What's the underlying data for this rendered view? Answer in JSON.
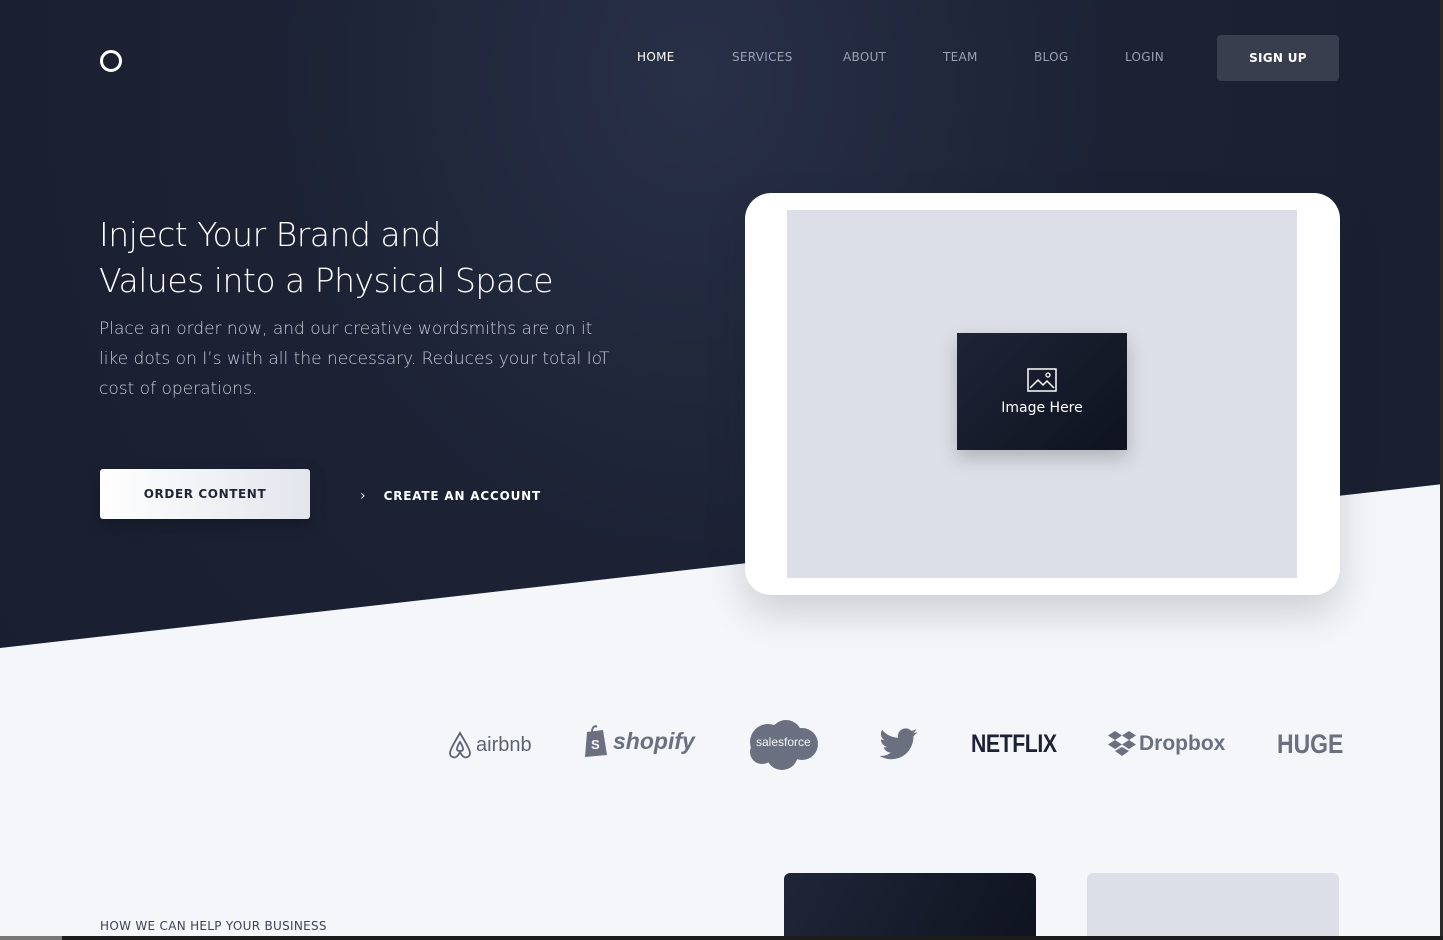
{
  "nav": {
    "items": [
      {
        "label": "HOME",
        "active": true
      },
      {
        "label": "SERVICES",
        "active": false
      },
      {
        "label": "ABOUT",
        "active": false
      },
      {
        "label": "TEAM",
        "active": false
      },
      {
        "label": "BLOG",
        "active": false
      },
      {
        "label": "LOGIN",
        "active": false
      }
    ],
    "signup_label": "SIGN UP"
  },
  "hero": {
    "headline_line1": "Inject Your Brand and",
    "headline_line2": "Values into a Physical Space",
    "subtext": "Place an order now, and our creative wordsmiths are on it like dots on I’s with all the necessary. Reduces your total IoT cost of operations.",
    "primary_cta": "ORDER CONTENT",
    "secondary_cta": "CREATE AN ACCOUNT",
    "image_placeholder": "Image Here"
  },
  "brands": [
    "airbnb",
    "shopify",
    "salesforce",
    "twitter",
    "NETFLIX",
    "Dropbox",
    "HUGE"
  ],
  "section": {
    "eyebrow": "HOW WE CAN HELP YOUR BUSINESS"
  },
  "colors": {
    "hero_bg": "#1c2234",
    "page_bg": "#f5f6fa",
    "signup_bg": "#383e4d",
    "placeholder_grey": "#dcdfe7"
  }
}
